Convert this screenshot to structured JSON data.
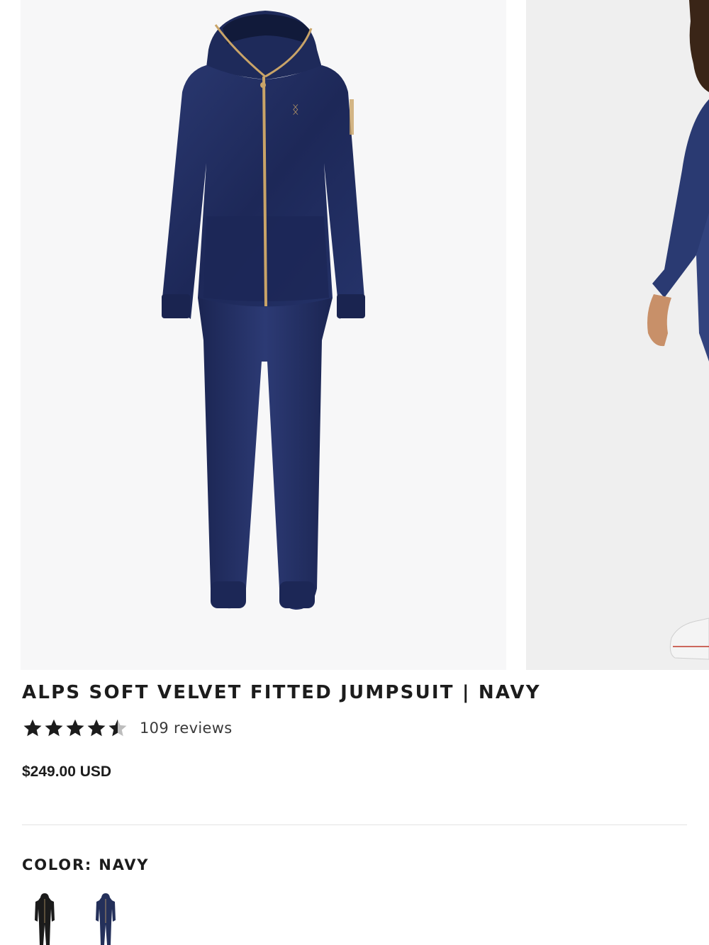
{
  "product": {
    "title": "ALPS SOFT VELVET FITTED JUMPSUIT | NAVY",
    "rating": 4.5,
    "review_count_label": "109 reviews",
    "price": "$249.00 USD"
  },
  "color": {
    "label": "COLOR: NAVY",
    "swatches": [
      {
        "name": "black",
        "color": "#1b1b1b"
      },
      {
        "name": "navy",
        "color": "#24305a"
      }
    ]
  },
  "gallery": {
    "slide_count_visible": 2
  },
  "colors": {
    "navy": "#1f2b5a",
    "zipper_gold": "#c9a468",
    "text": "#1c1c1c"
  }
}
